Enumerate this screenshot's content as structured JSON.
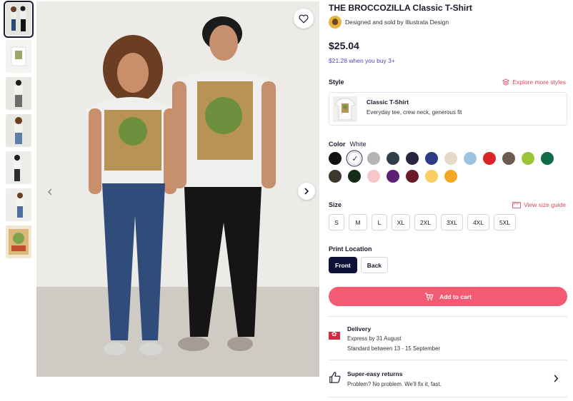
{
  "product": {
    "title": "THE BROCCOZILLA Classic T-Shirt",
    "seller": "Designed and sold by Illustrata Design",
    "price": "$25.04",
    "bulk_price": "$21.28 when you buy 3+"
  },
  "style": {
    "label": "Style",
    "explore_link": "Explore more styles",
    "name": "Classic T-Shirt",
    "description": "Everyday tee, crew neck, generous fit"
  },
  "color": {
    "label": "Color",
    "selected": "White",
    "swatches": [
      "#111111",
      "#ffffff",
      "#b5b5b5",
      "#2f3e4b",
      "#26263f",
      "#2e3a86",
      "#e7d9c6",
      "#9cc4e0",
      "#d9252a",
      "#6b5a4d",
      "#9ac43a",
      "#0d6b45",
      "#3d382d",
      "#142b18",
      "#f7c6c9",
      "#5d1f73",
      "#6b1a2a",
      "#f9ce63",
      "#f5a623"
    ],
    "selected_index": 1
  },
  "size": {
    "label": "Size",
    "guide_link": "View size guide",
    "options": [
      "S",
      "M",
      "L",
      "XL",
      "2XL",
      "3XL",
      "4XL",
      "5XL"
    ]
  },
  "print_location": {
    "label": "Print Location",
    "options": [
      "Front",
      "Back"
    ],
    "selected": "Front"
  },
  "cart": {
    "label": "Add to cart"
  },
  "delivery": {
    "title": "Delivery",
    "express": "Express by 31 August",
    "standard": "Standard between 13 - 15 September"
  },
  "returns": {
    "title": "Super-easy returns",
    "description": "Problem? No problem. We'll fix it, fast."
  },
  "icons": {
    "favorite": "heart-icon",
    "next": "chevron-right-icon",
    "prev": "chevron-left-icon",
    "explore": "layers-icon",
    "size_guide": "ruler-icon",
    "cart": "cart-icon",
    "delivery": "flag-icon",
    "returns": "thumbs-up-icon"
  }
}
